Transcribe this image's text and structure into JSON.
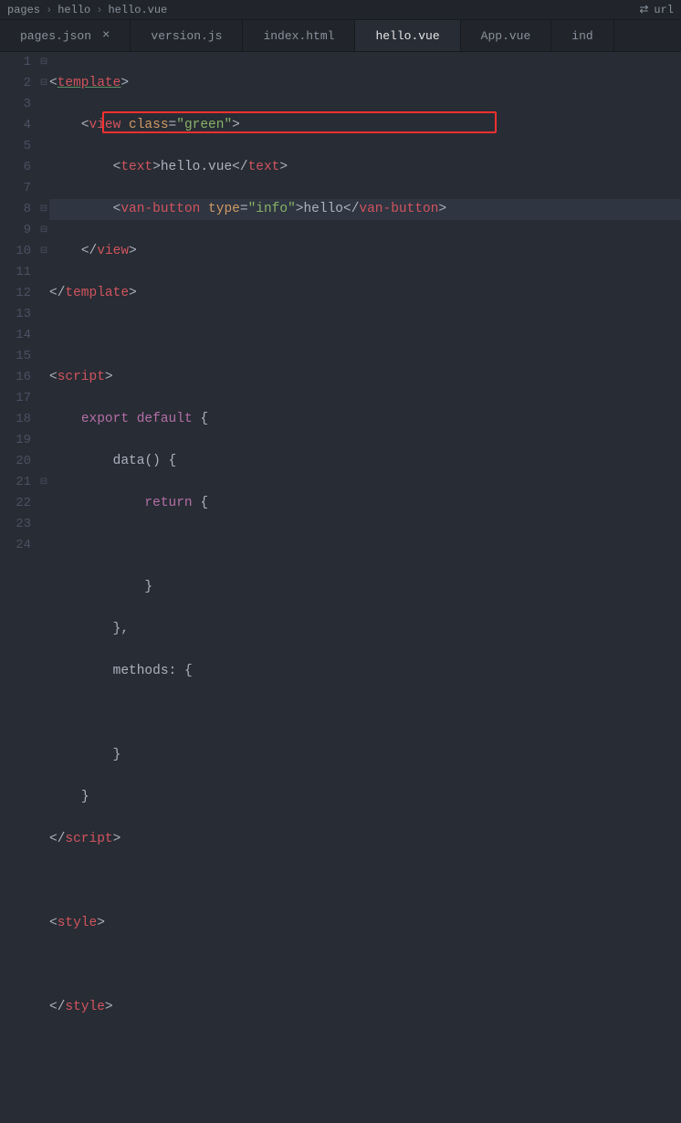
{
  "breadcrumb": {
    "root": "pages",
    "mid": "hello",
    "file": "hello.vue",
    "urlLabel": "url"
  },
  "tabs": [
    {
      "label": "pages.json",
      "active": false,
      "close": true
    },
    {
      "label": "version.js",
      "active": false,
      "close": false
    },
    {
      "label": "index.html",
      "active": false,
      "close": false
    },
    {
      "label": "hello.vue",
      "active": true,
      "close": false
    },
    {
      "label": "App.vue",
      "active": false,
      "close": false
    },
    {
      "label": "ind",
      "active": false,
      "close": false
    }
  ],
  "lines": {
    "count": 24,
    "fold": {
      "1": "⊟",
      "2": "⊟",
      "8": "⊟",
      "9": "⊟",
      "10": "⊟",
      "21": "⊟"
    }
  },
  "code": {
    "l1_template": "template",
    "l2_view": "view",
    "l2_class": "class",
    "l2_classval": "\"green\"",
    "l3_text": "text",
    "l3_content": "hello.vue",
    "l4_vanbutton": "van-button",
    "l4_type": "type",
    "l4_typeval": "\"info\"",
    "l4_content": "hello",
    "l5_viewclose": "view",
    "l6_templateclose": "template",
    "l8_script": "script",
    "l9_export": "export",
    "l9_default": "default",
    "l10_data": "data",
    "l11_return": "return",
    "l15_methods": "methods:",
    "l19_scriptclose": "script",
    "l21_style": "style",
    "l23_styleclose": "style"
  }
}
